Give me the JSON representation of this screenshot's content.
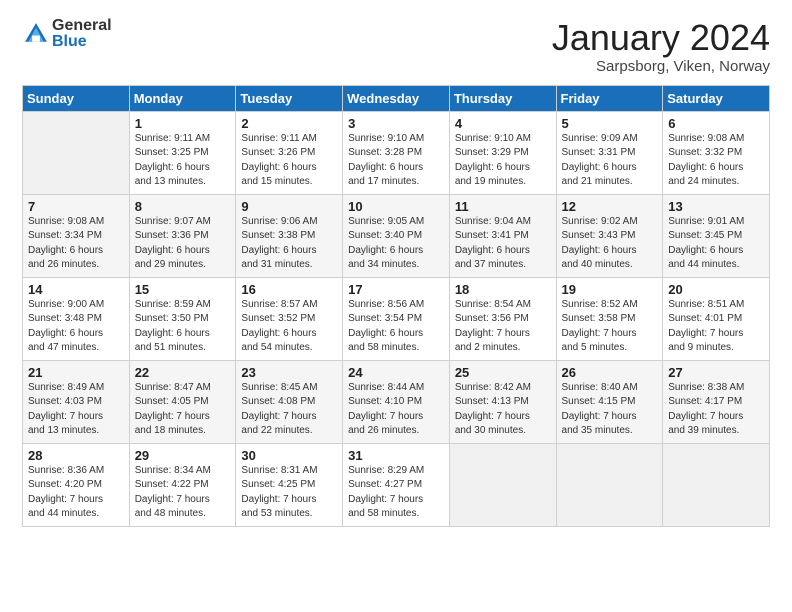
{
  "logo": {
    "general": "General",
    "blue": "Blue"
  },
  "header": {
    "month": "January 2024",
    "location": "Sarpsborg, Viken, Norway"
  },
  "weekdays": [
    "Sunday",
    "Monday",
    "Tuesday",
    "Wednesday",
    "Thursday",
    "Friday",
    "Saturday"
  ],
  "weeks": [
    [
      {
        "day": "",
        "info": ""
      },
      {
        "day": "1",
        "info": "Sunrise: 9:11 AM\nSunset: 3:25 PM\nDaylight: 6 hours\nand 13 minutes."
      },
      {
        "day": "2",
        "info": "Sunrise: 9:11 AM\nSunset: 3:26 PM\nDaylight: 6 hours\nand 15 minutes."
      },
      {
        "day": "3",
        "info": "Sunrise: 9:10 AM\nSunset: 3:28 PM\nDaylight: 6 hours\nand 17 minutes."
      },
      {
        "day": "4",
        "info": "Sunrise: 9:10 AM\nSunset: 3:29 PM\nDaylight: 6 hours\nand 19 minutes."
      },
      {
        "day": "5",
        "info": "Sunrise: 9:09 AM\nSunset: 3:31 PM\nDaylight: 6 hours\nand 21 minutes."
      },
      {
        "day": "6",
        "info": "Sunrise: 9:08 AM\nSunset: 3:32 PM\nDaylight: 6 hours\nand 24 minutes."
      }
    ],
    [
      {
        "day": "7",
        "info": "Sunrise: 9:08 AM\nSunset: 3:34 PM\nDaylight: 6 hours\nand 26 minutes."
      },
      {
        "day": "8",
        "info": "Sunrise: 9:07 AM\nSunset: 3:36 PM\nDaylight: 6 hours\nand 29 minutes."
      },
      {
        "day": "9",
        "info": "Sunrise: 9:06 AM\nSunset: 3:38 PM\nDaylight: 6 hours\nand 31 minutes."
      },
      {
        "day": "10",
        "info": "Sunrise: 9:05 AM\nSunset: 3:40 PM\nDaylight: 6 hours\nand 34 minutes."
      },
      {
        "day": "11",
        "info": "Sunrise: 9:04 AM\nSunset: 3:41 PM\nDaylight: 6 hours\nand 37 minutes."
      },
      {
        "day": "12",
        "info": "Sunrise: 9:02 AM\nSunset: 3:43 PM\nDaylight: 6 hours\nand 40 minutes."
      },
      {
        "day": "13",
        "info": "Sunrise: 9:01 AM\nSunset: 3:45 PM\nDaylight: 6 hours\nand 44 minutes."
      }
    ],
    [
      {
        "day": "14",
        "info": "Sunrise: 9:00 AM\nSunset: 3:48 PM\nDaylight: 6 hours\nand 47 minutes."
      },
      {
        "day": "15",
        "info": "Sunrise: 8:59 AM\nSunset: 3:50 PM\nDaylight: 6 hours\nand 51 minutes."
      },
      {
        "day": "16",
        "info": "Sunrise: 8:57 AM\nSunset: 3:52 PM\nDaylight: 6 hours\nand 54 minutes."
      },
      {
        "day": "17",
        "info": "Sunrise: 8:56 AM\nSunset: 3:54 PM\nDaylight: 6 hours\nand 58 minutes."
      },
      {
        "day": "18",
        "info": "Sunrise: 8:54 AM\nSunset: 3:56 PM\nDaylight: 7 hours\nand 2 minutes."
      },
      {
        "day": "19",
        "info": "Sunrise: 8:52 AM\nSunset: 3:58 PM\nDaylight: 7 hours\nand 5 minutes."
      },
      {
        "day": "20",
        "info": "Sunrise: 8:51 AM\nSunset: 4:01 PM\nDaylight: 7 hours\nand 9 minutes."
      }
    ],
    [
      {
        "day": "21",
        "info": "Sunrise: 8:49 AM\nSunset: 4:03 PM\nDaylight: 7 hours\nand 13 minutes."
      },
      {
        "day": "22",
        "info": "Sunrise: 8:47 AM\nSunset: 4:05 PM\nDaylight: 7 hours\nand 18 minutes."
      },
      {
        "day": "23",
        "info": "Sunrise: 8:45 AM\nSunset: 4:08 PM\nDaylight: 7 hours\nand 22 minutes."
      },
      {
        "day": "24",
        "info": "Sunrise: 8:44 AM\nSunset: 4:10 PM\nDaylight: 7 hours\nand 26 minutes."
      },
      {
        "day": "25",
        "info": "Sunrise: 8:42 AM\nSunset: 4:13 PM\nDaylight: 7 hours\nand 30 minutes."
      },
      {
        "day": "26",
        "info": "Sunrise: 8:40 AM\nSunset: 4:15 PM\nDaylight: 7 hours\nand 35 minutes."
      },
      {
        "day": "27",
        "info": "Sunrise: 8:38 AM\nSunset: 4:17 PM\nDaylight: 7 hours\nand 39 minutes."
      }
    ],
    [
      {
        "day": "28",
        "info": "Sunrise: 8:36 AM\nSunset: 4:20 PM\nDaylight: 7 hours\nand 44 minutes."
      },
      {
        "day": "29",
        "info": "Sunrise: 8:34 AM\nSunset: 4:22 PM\nDaylight: 7 hours\nand 48 minutes."
      },
      {
        "day": "30",
        "info": "Sunrise: 8:31 AM\nSunset: 4:25 PM\nDaylight: 7 hours\nand 53 minutes."
      },
      {
        "day": "31",
        "info": "Sunrise: 8:29 AM\nSunset: 4:27 PM\nDaylight: 7 hours\nand 58 minutes."
      },
      {
        "day": "",
        "info": ""
      },
      {
        "day": "",
        "info": ""
      },
      {
        "day": "",
        "info": ""
      }
    ]
  ]
}
